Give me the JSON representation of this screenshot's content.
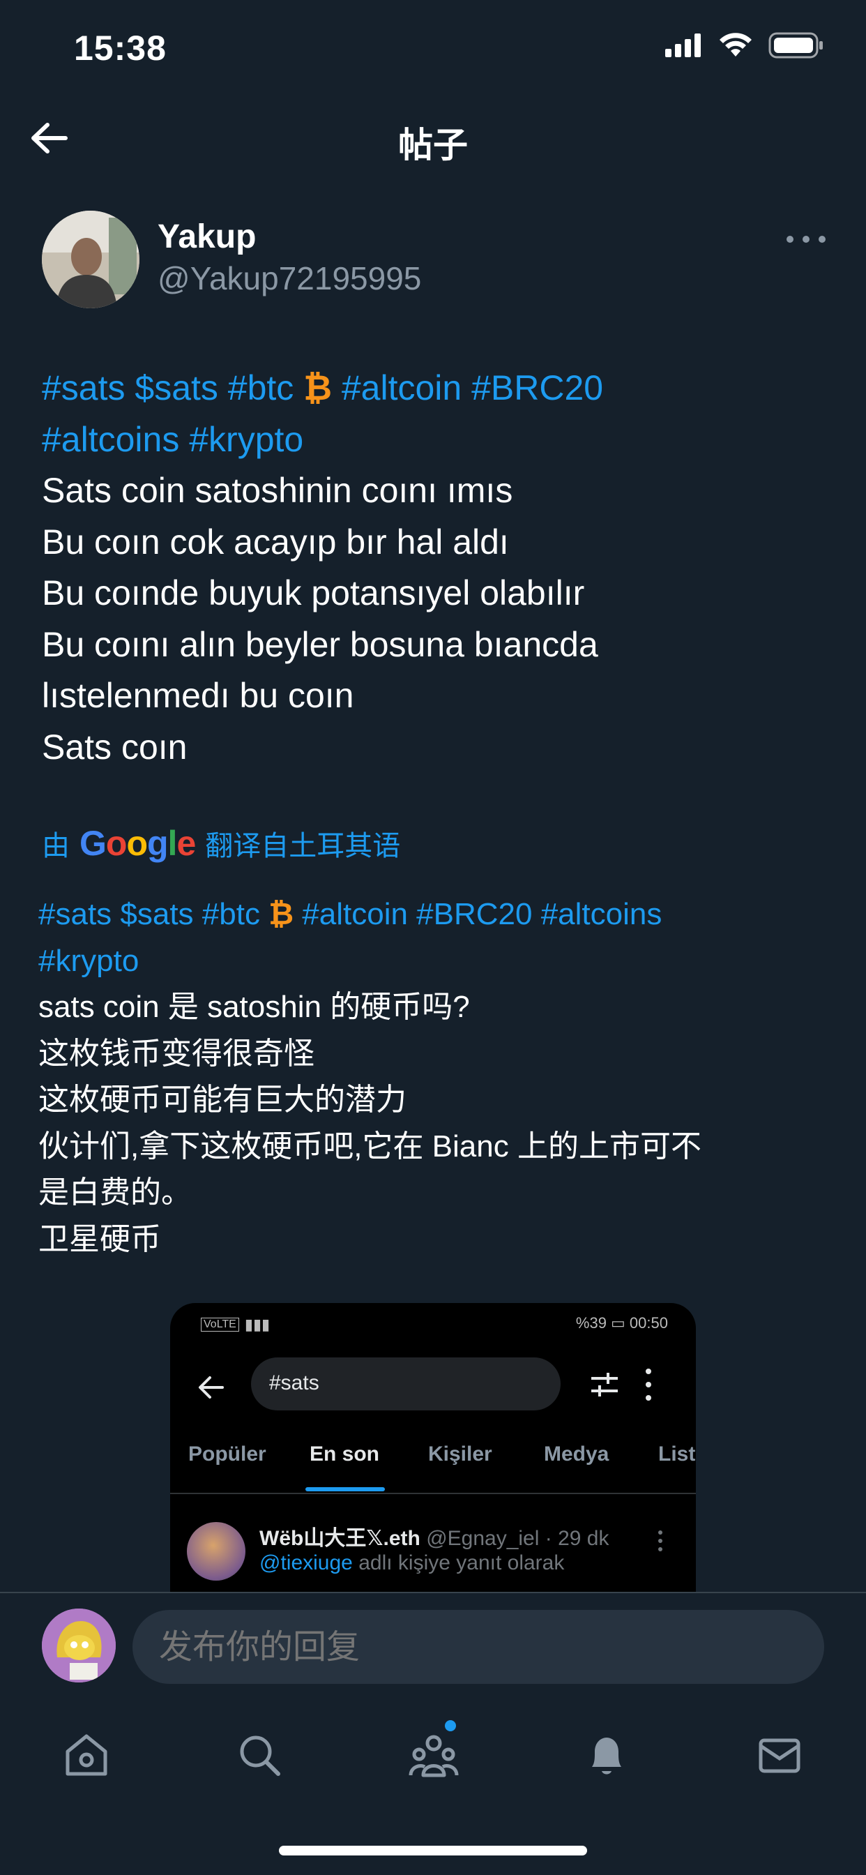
{
  "status_bar": {
    "time": "15:38"
  },
  "header": {
    "title": "帖子"
  },
  "author": {
    "name": "Yakup",
    "handle": "@Yakup72195995"
  },
  "tweet": {
    "line1": {
      "t1": "#sats $sats #btc",
      "btc": "₿",
      "t2": "#altcoin #BRC20"
    },
    "line2": "#altcoins #krypto",
    "line3": "Sats coin satoshinin coını ımıs",
    "line4": "Bu coın cok acayıp bır hal aldı",
    "line5": "Bu coınde buyuk potansıyel olabılır",
    "line6": "Bu coını alın beyler bosuna bıancda",
    "line7": "lıstelenmedı bu coın",
    "line8": "Sats coın"
  },
  "translation": {
    "prefix": "由",
    "google": {
      "G": "G",
      "o1": "o",
      "o2": "o",
      "g": "g",
      "l": "l",
      "e": "e"
    },
    "suffix": "翻译自土耳其语",
    "line1": {
      "t1": "#sats $sats #btc",
      "btc": "₿",
      "t2": "#altcoin #BRC20 #altcoins"
    },
    "line2": "#krypto",
    "line3": "sats coin 是 satoshin 的硬币吗?",
    "line4": "这枚钱币变得很奇怪",
    "line5": "这枚硬币可能有巨大的潜力",
    "line6": "伙计们,拿下这枚硬币吧,它在 Bianc 上的上市可不",
    "line7": "是白费的。",
    "line8": "卫星硬币"
  },
  "embedded_screenshot": {
    "status_left": "VoLTE",
    "status_right": "%39 ▭ 00:50",
    "search_value": "#sats",
    "tabs": [
      "Popüler",
      "En son",
      "Kişiler",
      "Medya",
      "List"
    ],
    "active_tab": "En son",
    "tweet_name": "Wëb山大王𝕏.eth",
    "tweet_meta": "@Egnay_iel · 29 dk",
    "reply_mention": "@tiexiuge",
    "reply_text": "adlı kişiye yanıt olarak"
  },
  "reply": {
    "placeholder": "发布你的回复"
  },
  "colors": {
    "background": "#15202b",
    "accent": "#1d9bf0",
    "bitcoin": "#f7931a",
    "muted": "#8b98a5"
  },
  "bottom_nav": [
    "home-icon",
    "search-icon",
    "communities-icon",
    "notifications-icon",
    "messages-icon"
  ]
}
